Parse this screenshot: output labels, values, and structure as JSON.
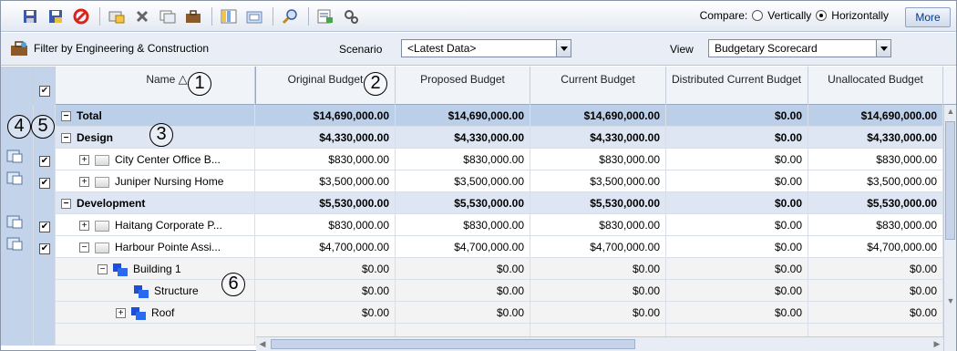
{
  "toolbar": {
    "icons": [
      "save-icon",
      "save-as-icon",
      "cancel-icon",
      "copy-icon",
      "delete-icon",
      "duplicate-icon",
      "briefcase-icon",
      "columns-icon",
      "import-icon",
      "find-icon",
      "export-icon",
      "settings-icon"
    ],
    "compare_label": "Compare:",
    "vertically_label": "Vertically",
    "horizontally_label": "Horizontally",
    "compare_selected": "Horizontally",
    "more_label": "More"
  },
  "filterbar": {
    "filter_label": "Filter by Engineering & Construction",
    "scenario_label": "Scenario",
    "scenario_value": "<Latest Data>",
    "view_label": "View",
    "view_value": "Budgetary Scorecard"
  },
  "grid": {
    "headers": {
      "name": "Name",
      "original": "Original Budget",
      "proposed": "Proposed Budget",
      "current": "Current Budget",
      "distributed": "Distributed Current Budget",
      "unallocated": "Unallocated Budget"
    },
    "rows": [
      {
        "name": "Total",
        "type": "total",
        "expander": "−",
        "original": "$14,690,000.00",
        "proposed": "$14,690,000.00",
        "current": "$14,690,000.00",
        "distributed": "$0.00",
        "unallocated": "$14,690,000.00"
      },
      {
        "name": "Design",
        "type": "group",
        "expander": "−",
        "original": "$4,330,000.00",
        "proposed": "$4,330,000.00",
        "current": "$4,330,000.00",
        "distributed": "$0.00",
        "unallocated": "$4,330,000.00"
      },
      {
        "name": "City Center Office B...",
        "type": "item",
        "expander": "+",
        "original": "$830,000.00",
        "proposed": "$830,000.00",
        "current": "$830,000.00",
        "distributed": "$0.00",
        "unallocated": "$830,000.00"
      },
      {
        "name": "Juniper Nursing Home",
        "type": "item",
        "expander": "+",
        "original": "$3,500,000.00",
        "proposed": "$3,500,000.00",
        "current": "$3,500,000.00",
        "distributed": "$0.00",
        "unallocated": "$3,500,000.00"
      },
      {
        "name": "Development",
        "type": "group",
        "expander": "−",
        "original": "$5,530,000.00",
        "proposed": "$5,530,000.00",
        "current": "$5,530,000.00",
        "distributed": "$0.00",
        "unallocated": "$5,530,000.00"
      },
      {
        "name": "Haitang Corporate P...",
        "type": "item",
        "expander": "+",
        "original": "$830,000.00",
        "proposed": "$830,000.00",
        "current": "$830,000.00",
        "distributed": "$0.00",
        "unallocated": "$830,000.00"
      },
      {
        "name": "Harbour Pointe Assi...",
        "type": "item",
        "expander": "−",
        "original": "$4,700,000.00",
        "proposed": "$4,700,000.00",
        "current": "$4,700,000.00",
        "distributed": "$0.00",
        "unallocated": "$4,700,000.00"
      },
      {
        "name": "Building 1",
        "type": "sub",
        "expander": "−",
        "original": "$0.00",
        "proposed": "$0.00",
        "current": "$0.00",
        "distributed": "$0.00",
        "unallocated": "$0.00"
      },
      {
        "name": "Structure",
        "type": "sub",
        "expander": "",
        "original": "$0.00",
        "proposed": "$0.00",
        "current": "$0.00",
        "distributed": "$0.00",
        "unallocated": "$0.00"
      },
      {
        "name": "Roof",
        "type": "sub",
        "expander": "+",
        "original": "$0.00",
        "proposed": "$0.00",
        "current": "$0.00",
        "distributed": "$0.00",
        "unallocated": "$0.00"
      },
      {
        "name": "",
        "type": "sub",
        "expander": "",
        "original": "",
        "proposed": "",
        "current": "",
        "distributed": "",
        "unallocated": ""
      }
    ]
  },
  "callouts": [
    "1",
    "2",
    "3",
    "4",
    "5",
    "6"
  ]
}
